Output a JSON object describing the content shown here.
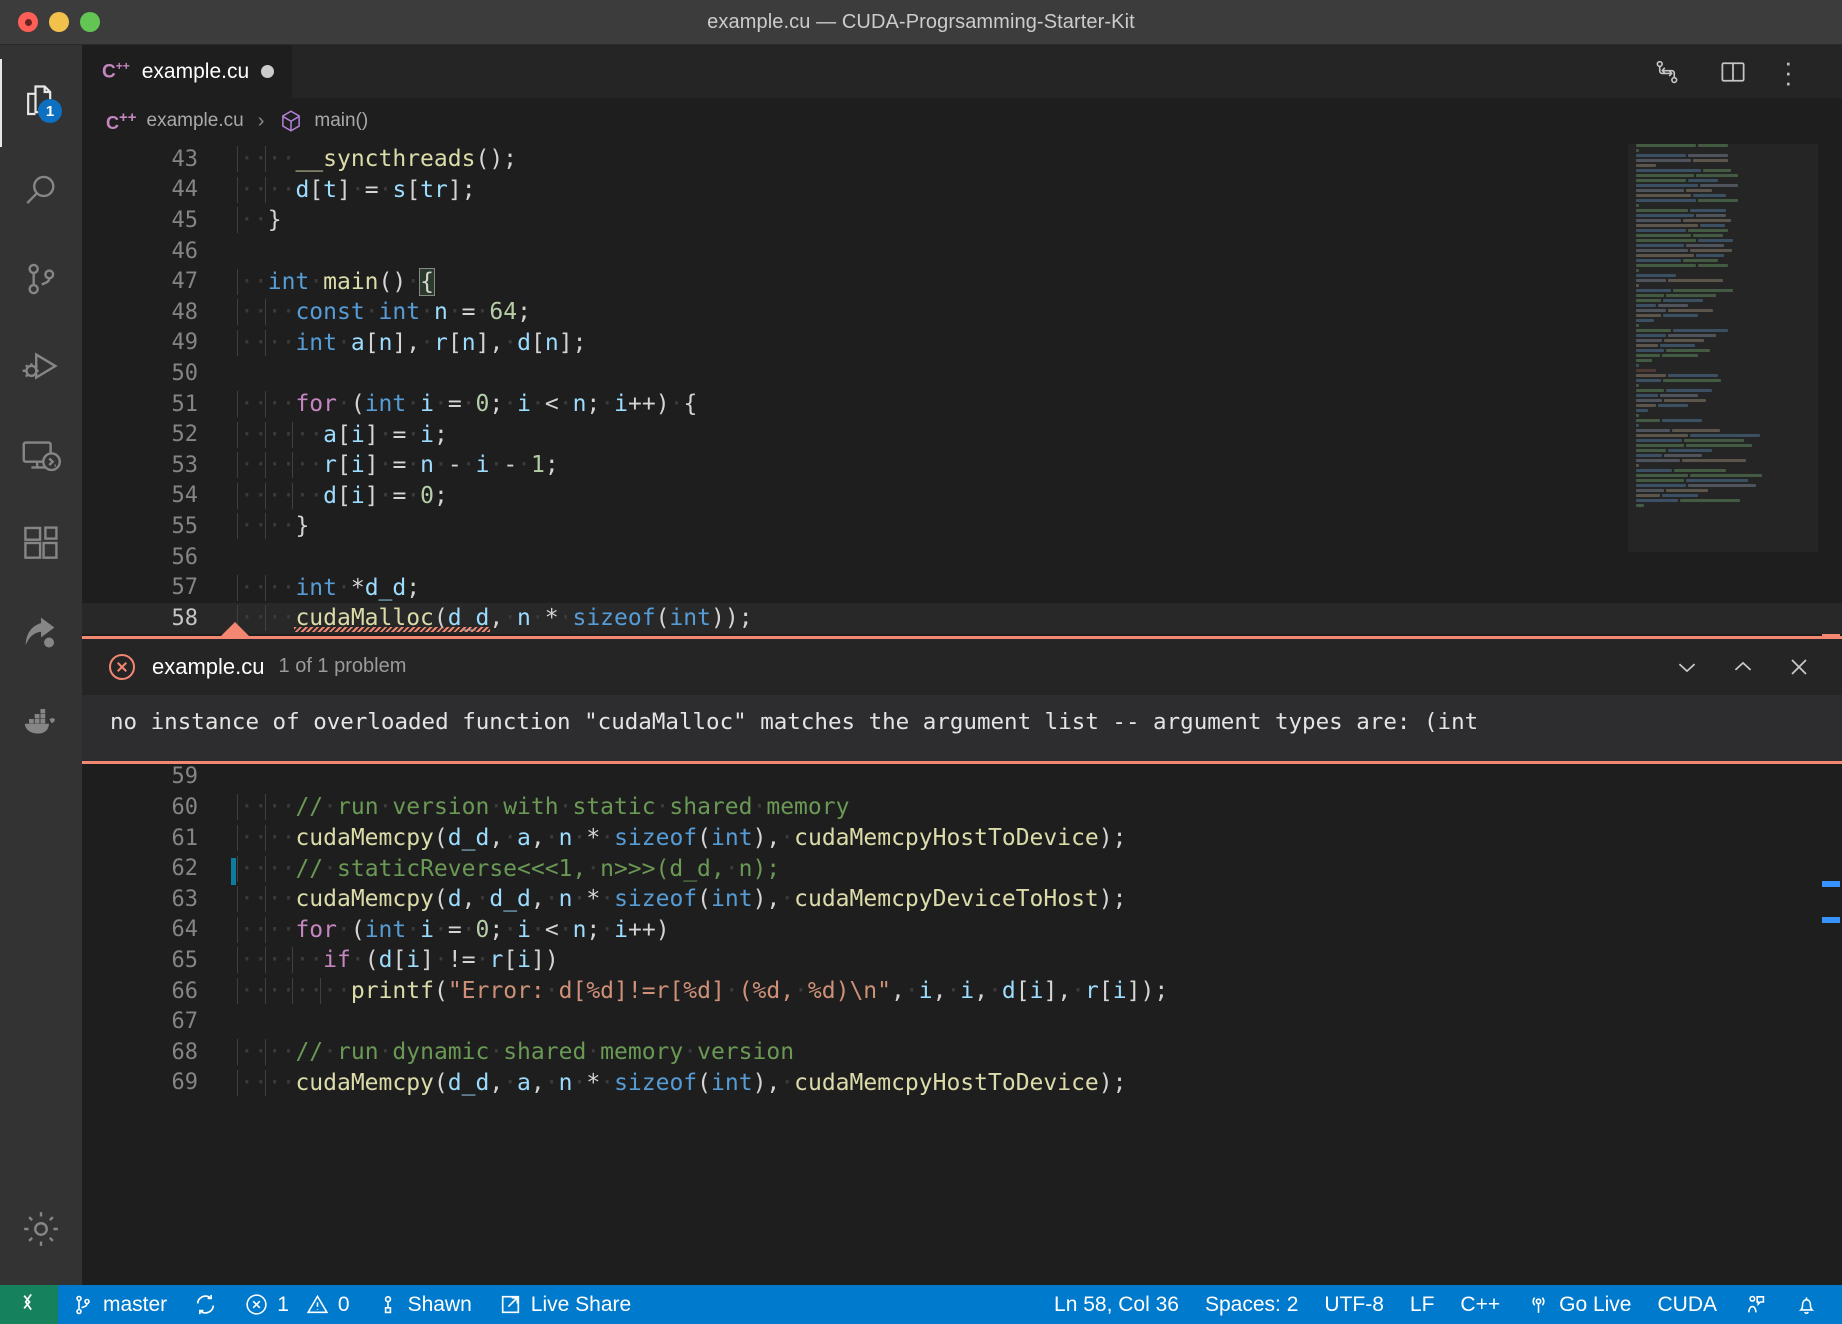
{
  "window": {
    "title": "example.cu — CUDA-Progrsamming-Starter-Kit",
    "traffic_colors": {
      "close": "#ff5f57",
      "minimize": "#f2c14b",
      "zoom": "#62c554"
    }
  },
  "activitybar": {
    "items": [
      {
        "name": "explorer",
        "icon": "files-icon",
        "badge": "1",
        "active": true
      },
      {
        "name": "search",
        "icon": "search-icon",
        "badge": "",
        "active": false
      },
      {
        "name": "source-control",
        "icon": "source-control-icon",
        "badge": "",
        "active": false
      },
      {
        "name": "run-and-debug",
        "icon": "run-debug-icon",
        "badge": "",
        "active": false
      },
      {
        "name": "remote-explorer",
        "icon": "remote-explorer-icon",
        "badge": "",
        "active": false
      },
      {
        "name": "extensions",
        "icon": "extensions-icon",
        "badge": "",
        "active": false
      },
      {
        "name": "live-share",
        "icon": "live-share-icon",
        "badge": "",
        "active": false
      },
      {
        "name": "docker",
        "icon": "docker-icon",
        "badge": "",
        "active": false
      }
    ],
    "bottom": [
      {
        "name": "manage",
        "icon": "gear-icon"
      }
    ]
  },
  "tabs": {
    "items": [
      {
        "lang": "C",
        "lang_sup": "++",
        "label": "example.cu",
        "dirty": true,
        "active": true
      }
    ],
    "actions": [
      {
        "name": "compare-changes-button",
        "icon": "compare-icon"
      },
      {
        "name": "split-editor-button",
        "icon": "split-editor-icon"
      },
      {
        "name": "more-actions-button",
        "icon": "ellipsis-icon",
        "label": "· · ·"
      }
    ]
  },
  "breadcrumbs": {
    "lang": "C",
    "lang_sup": "++",
    "file": "example.cu",
    "separator": "›",
    "symbol": "main()"
  },
  "editor": {
    "first_line": 43,
    "current_line": 58,
    "bracket_match_line": 47,
    "modified_lines": [
      62
    ],
    "error_line": 58,
    "lines": [
      {
        "n": 43,
        "text": "    __syncthreads();"
      },
      {
        "n": 44,
        "text": "    d[t] = s[tr];"
      },
      {
        "n": 45,
        "text": "  }"
      },
      {
        "n": 46,
        "text": ""
      },
      {
        "n": 47,
        "text": "  int main() {"
      },
      {
        "n": 48,
        "text": "    const int n = 64;"
      },
      {
        "n": 49,
        "text": "    int a[n], r[n], d[n];"
      },
      {
        "n": 50,
        "text": ""
      },
      {
        "n": 51,
        "text": "    for (int i = 0; i < n; i++) {"
      },
      {
        "n": 52,
        "text": "      a[i] = i;"
      },
      {
        "n": 53,
        "text": "      r[i] = n - i - 1;"
      },
      {
        "n": 54,
        "text": "      d[i] = 0;"
      },
      {
        "n": 55,
        "text": "    }"
      },
      {
        "n": 56,
        "text": ""
      },
      {
        "n": 57,
        "text": "    int *d_d;"
      },
      {
        "n": 58,
        "text": "    cudaMalloc(d_d, n * sizeof(int));"
      },
      {
        "n": 59,
        "text": ""
      },
      {
        "n": 60,
        "text": "    // run version with static shared memory"
      },
      {
        "n": 61,
        "text": "    cudaMemcpy(d_d, a, n * sizeof(int), cudaMemcpyHostToDevice);"
      },
      {
        "n": 62,
        "text": "    // staticReverse<<<1, n>>>(d_d, n);"
      },
      {
        "n": 63,
        "text": "    cudaMemcpy(d, d_d, n * sizeof(int), cudaMemcpyDeviceToHost);"
      },
      {
        "n": 64,
        "text": "    for (int i = 0; i < n; i++)"
      },
      {
        "n": 65,
        "text": "      if (d[i] != r[i])"
      },
      {
        "n": 66,
        "text": "        printf(\"Error: d[%d]!=r[%d] (%d, %d)\\n\", i, i, d[i], r[i]);"
      },
      {
        "n": 67,
        "text": ""
      },
      {
        "n": 68,
        "text": "    // run dynamic shared memory version"
      },
      {
        "n": 69,
        "text": "    cudaMemcpy(d_d, a, n * sizeof(int), cudaMemcpyHostToDevice);"
      }
    ]
  },
  "peek": {
    "icon": "error-circle-icon",
    "file": "example.cu",
    "count_label": "1 of 1 problem",
    "message": "no instance of overloaded function \"cudaMalloc\" matches the argument list -- argument types are: (int",
    "actions": [
      {
        "name": "next-problem-button",
        "icon": "chevron-down-icon"
      },
      {
        "name": "previous-problem-button",
        "icon": "chevron-up-icon"
      },
      {
        "name": "close-peek-button",
        "icon": "close-icon"
      }
    ],
    "border_color": "#f48771"
  },
  "statusbar": {
    "background": "#007acc",
    "remote_background": "#16825d",
    "left": [
      {
        "name": "remote-indicator",
        "icon": "remote-icon",
        "label": ""
      },
      {
        "name": "branch-indicator",
        "icon": "git-branch-icon",
        "label": "master"
      },
      {
        "name": "sync-button",
        "icon": "sync-icon",
        "label": ""
      },
      {
        "name": "problems-indicator",
        "icon": "error-warning-icon",
        "errors": "1",
        "warnings": "0"
      },
      {
        "name": "account-indicator",
        "icon": "person-icon",
        "label": "Shawn"
      },
      {
        "name": "live-share-button",
        "icon": "live-share-status-icon",
        "label": "Live Share"
      }
    ],
    "right": [
      {
        "name": "cursor-position",
        "label": "Ln 58, Col 36"
      },
      {
        "name": "indentation",
        "label": "Spaces: 2"
      },
      {
        "name": "encoding",
        "label": "UTF-8"
      },
      {
        "name": "eol",
        "label": "LF"
      },
      {
        "name": "language-mode",
        "label": "C++"
      },
      {
        "name": "go-live-button",
        "icon": "broadcast-icon",
        "label": "Go Live"
      },
      {
        "name": "cuda-indicator",
        "label": "CUDA"
      },
      {
        "name": "feedback-button",
        "icon": "feedback-icon",
        "label": ""
      },
      {
        "name": "notifications-button",
        "icon": "bell-icon",
        "label": ""
      }
    ]
  },
  "colors": {
    "editor_background": "#1e1e1e",
    "activitybar_background": "#333333",
    "titlebar_background": "#3c3c3c",
    "error": "#f48771",
    "accent": "#007acc",
    "badge": "#0e70c0"
  }
}
